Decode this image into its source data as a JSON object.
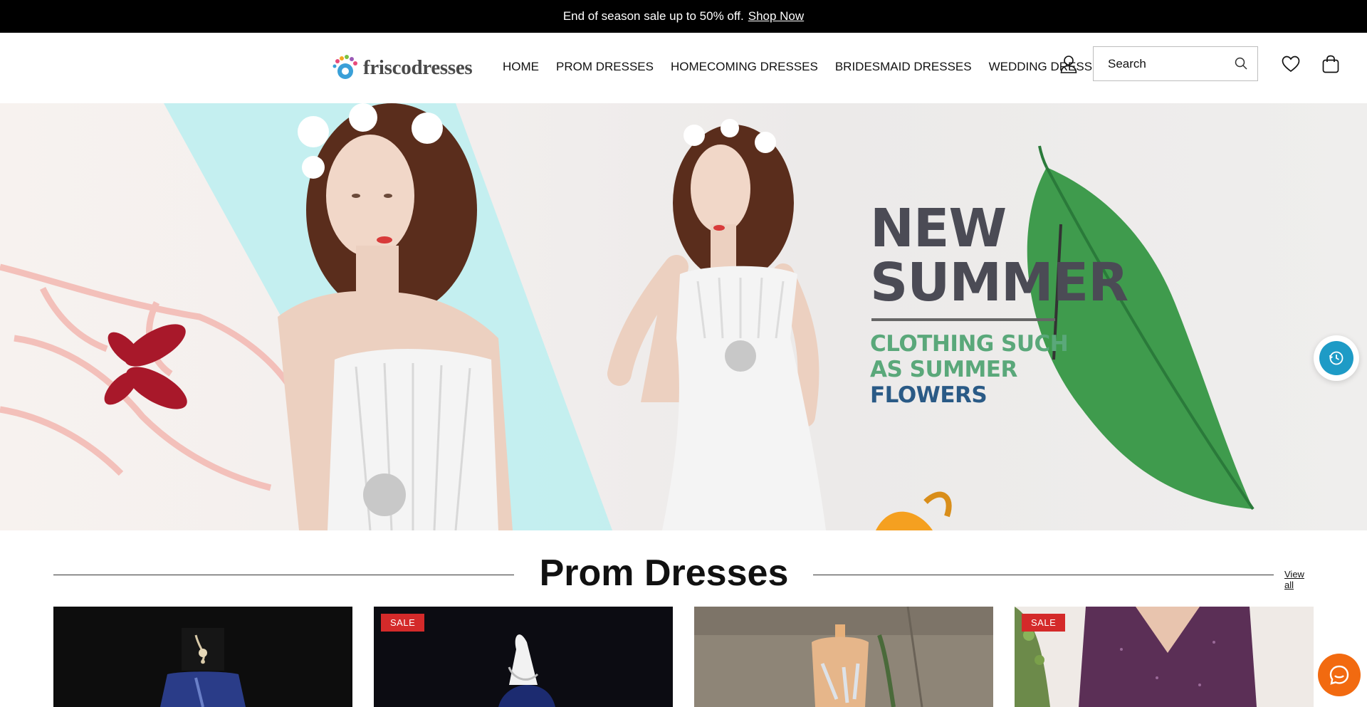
{
  "announcement": {
    "text": "End of season sale up to 50% off.",
    "link": "Shop Now"
  },
  "header": {
    "logo_text": "friscodresses",
    "nav": [
      {
        "label": "HOME"
      },
      {
        "label": "PROM DRESSES"
      },
      {
        "label": "HOMECOMING DRESSES"
      },
      {
        "label": "BRIDESMAID DRESSES"
      },
      {
        "label": "WEDDING DRESSES"
      }
    ],
    "search_placeholder": "Search",
    "icons": [
      "account-icon",
      "search-icon",
      "wishlist-icon",
      "cart-icon"
    ]
  },
  "hero": {
    "title_line1": "NEW",
    "title_line2": "SUMMER",
    "sub_line1": "CLOTHING SUCH",
    "sub_line2": "AS SUMMER",
    "sub_line3": "FLOWERS"
  },
  "section": {
    "title": "Prom Dresses",
    "view_all": "View all"
  },
  "products": [
    {
      "badge": ""
    },
    {
      "badge": "SALE"
    },
    {
      "badge": ""
    },
    {
      "badge": "SALE"
    }
  ],
  "colors": {
    "announcement_bg": "#000000",
    "sale_badge": "#d42a2a",
    "chat_button": "#f26a10",
    "history_button": "#1e9bc6"
  }
}
